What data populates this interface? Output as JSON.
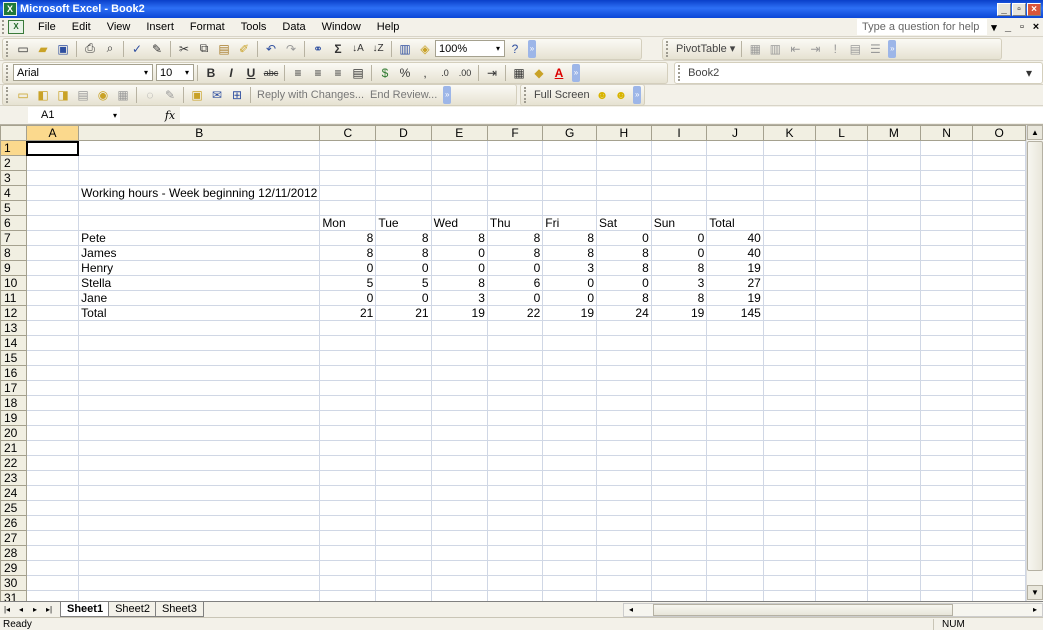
{
  "window": {
    "title": "Microsoft Excel - Book2"
  },
  "menu": {
    "items": [
      "File",
      "Edit",
      "View",
      "Insert",
      "Format",
      "Tools",
      "Data",
      "Window",
      "Help"
    ],
    "help_placeholder": "Type a question for help"
  },
  "toolbar": {
    "zoom": "100%",
    "pivot_label": "PivotTable ▾",
    "font_name": "Arial",
    "font_size": "10",
    "book_name": "Book2",
    "reply_label": "Reply with Changes...",
    "end_review_label": "End Review...",
    "full_screen_label": "Full Screen"
  },
  "formula": {
    "name_box": "A1",
    "fx": "fx",
    "value": ""
  },
  "sheet": {
    "columns": [
      "A",
      "B",
      "C",
      "D",
      "E",
      "F",
      "G",
      "H",
      "I",
      "J",
      "K",
      "L",
      "M",
      "N",
      "O"
    ],
    "row_count": 31,
    "title_cell": "Working hours - Week beginning 12/11/2012",
    "header_row": [
      "Mon",
      "Tue",
      "Wed",
      "Thu",
      "Fri",
      "Sat",
      "Sun",
      "Total"
    ],
    "rows": [
      {
        "name": "Pete",
        "values": [
          8,
          8,
          8,
          8,
          8,
          0,
          0,
          40
        ]
      },
      {
        "name": "James",
        "values": [
          8,
          8,
          0,
          8,
          8,
          8,
          0,
          40
        ]
      },
      {
        "name": "Henry",
        "values": [
          0,
          0,
          0,
          0,
          3,
          8,
          8,
          19
        ]
      },
      {
        "name": "Stella",
        "values": [
          5,
          5,
          8,
          6,
          0,
          0,
          3,
          27
        ]
      },
      {
        "name": "Jane",
        "values": [
          0,
          0,
          3,
          0,
          0,
          8,
          8,
          19
        ]
      },
      {
        "name": "Total",
        "values": [
          21,
          21,
          19,
          22,
          19,
          24,
          19,
          145
        ]
      }
    ]
  },
  "tabs": [
    "Sheet1",
    "Sheet2",
    "Sheet3"
  ],
  "active_tab": "Sheet1",
  "status": {
    "left": "Ready",
    "num": "NUM"
  }
}
